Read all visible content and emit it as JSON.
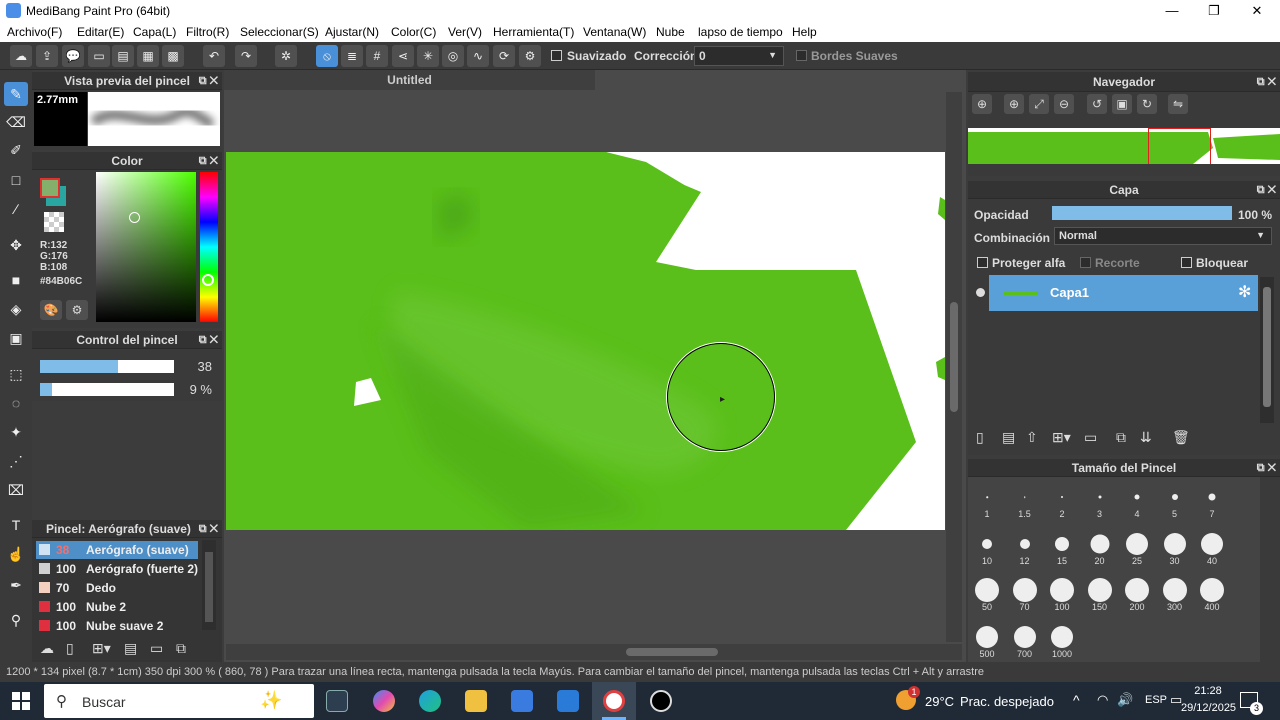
{
  "window": {
    "title": "MediBang Paint Pro (64bit)",
    "min": "—",
    "restore": "❐",
    "close": "✕"
  },
  "menu": [
    "Archivo(F)",
    "Editar(E)",
    "Capa(L)",
    "Filtro(R)",
    "Seleccionar(S)",
    "Ajustar(N)",
    "Color(C)",
    "Ver(V)",
    "Herramienta(T)",
    "Ventana(W)",
    "Nube",
    "lapso de tiempo",
    "Help"
  ],
  "toolbar": {
    "suavizado_label": "Suavizado",
    "correccion_label": "Corrección",
    "correccion_value": "0",
    "bordes_label": "Bordes Suaves"
  },
  "brush_preview": {
    "title": "Vista previa del pincel",
    "size": "2.77mm"
  },
  "color_panel": {
    "title": "Color",
    "r": "R:132",
    "g": "G:176",
    "b": "B:108",
    "hex": "#84B06C",
    "fg_color": "#84b06c",
    "bg_color": "#2aa6a0"
  },
  "brush_control": {
    "title": "Control del pincel",
    "size_value": "38",
    "size_fraction": 0.58,
    "opacity_value": "9 %",
    "opacity_fraction": 0.09
  },
  "brush_list": {
    "title": "Pincel: Aerógrafo (suave)",
    "items": [
      {
        "size": "38",
        "name": "Aerógrafo (suave)",
        "color": "#cfe3f5",
        "selected": true
      },
      {
        "size": "100",
        "name": "Aerógrafo (fuerte 2)",
        "color": "#d0d0d0",
        "selected": false
      },
      {
        "size": "70",
        "name": "Dedo",
        "color": "#f5d0c0",
        "selected": false
      },
      {
        "size": "100",
        "name": "Nube 2",
        "color": "#e03040",
        "selected": false
      },
      {
        "size": "100",
        "name": "Nube suave 2",
        "color": "#e03040",
        "selected": false
      }
    ]
  },
  "document": {
    "tab": "Untitled"
  },
  "navigator": {
    "title": "Navegador"
  },
  "layer_panel": {
    "title": "Capa",
    "opacity_label": "Opacidad",
    "opacity_value": "100 %",
    "opacity_fraction": 1.0,
    "blend_label": "Combinación",
    "blend_value": "Normal",
    "protect_alpha": "Proteger alfa",
    "clip": "Recorte",
    "lock": "Bloquear",
    "layers": [
      {
        "name": "Capa1"
      }
    ]
  },
  "brush_size": {
    "title": "Tamaño del Pincel",
    "sizes": [
      "1",
      "1.5",
      "2",
      "3",
      "4",
      "5",
      "7",
      "10",
      "12",
      "15",
      "20",
      "25",
      "30",
      "40",
      "50",
      "70",
      "100",
      "150",
      "200",
      "300",
      "400",
      "500",
      "700",
      "1000"
    ]
  },
  "status": {
    "text": "1200 * 134 pixel   (8.7 * 1cm)   350 dpi   300 %   ( 860, 78 )   Para trazar una línea recta, mantenga pulsada la tecla Mayús. Para cambiar el tamaño del pincel, mantenga pulsada las teclas Ctrl + Alt y arrastre"
  },
  "taskbar": {
    "search": "Buscar",
    "weather_temp": "29°C",
    "weather_text": "Prac. despejado",
    "lang": "ESP",
    "time": "21:28",
    "date": "29/12/2025",
    "notif": "3",
    "weather_badge": "1"
  }
}
